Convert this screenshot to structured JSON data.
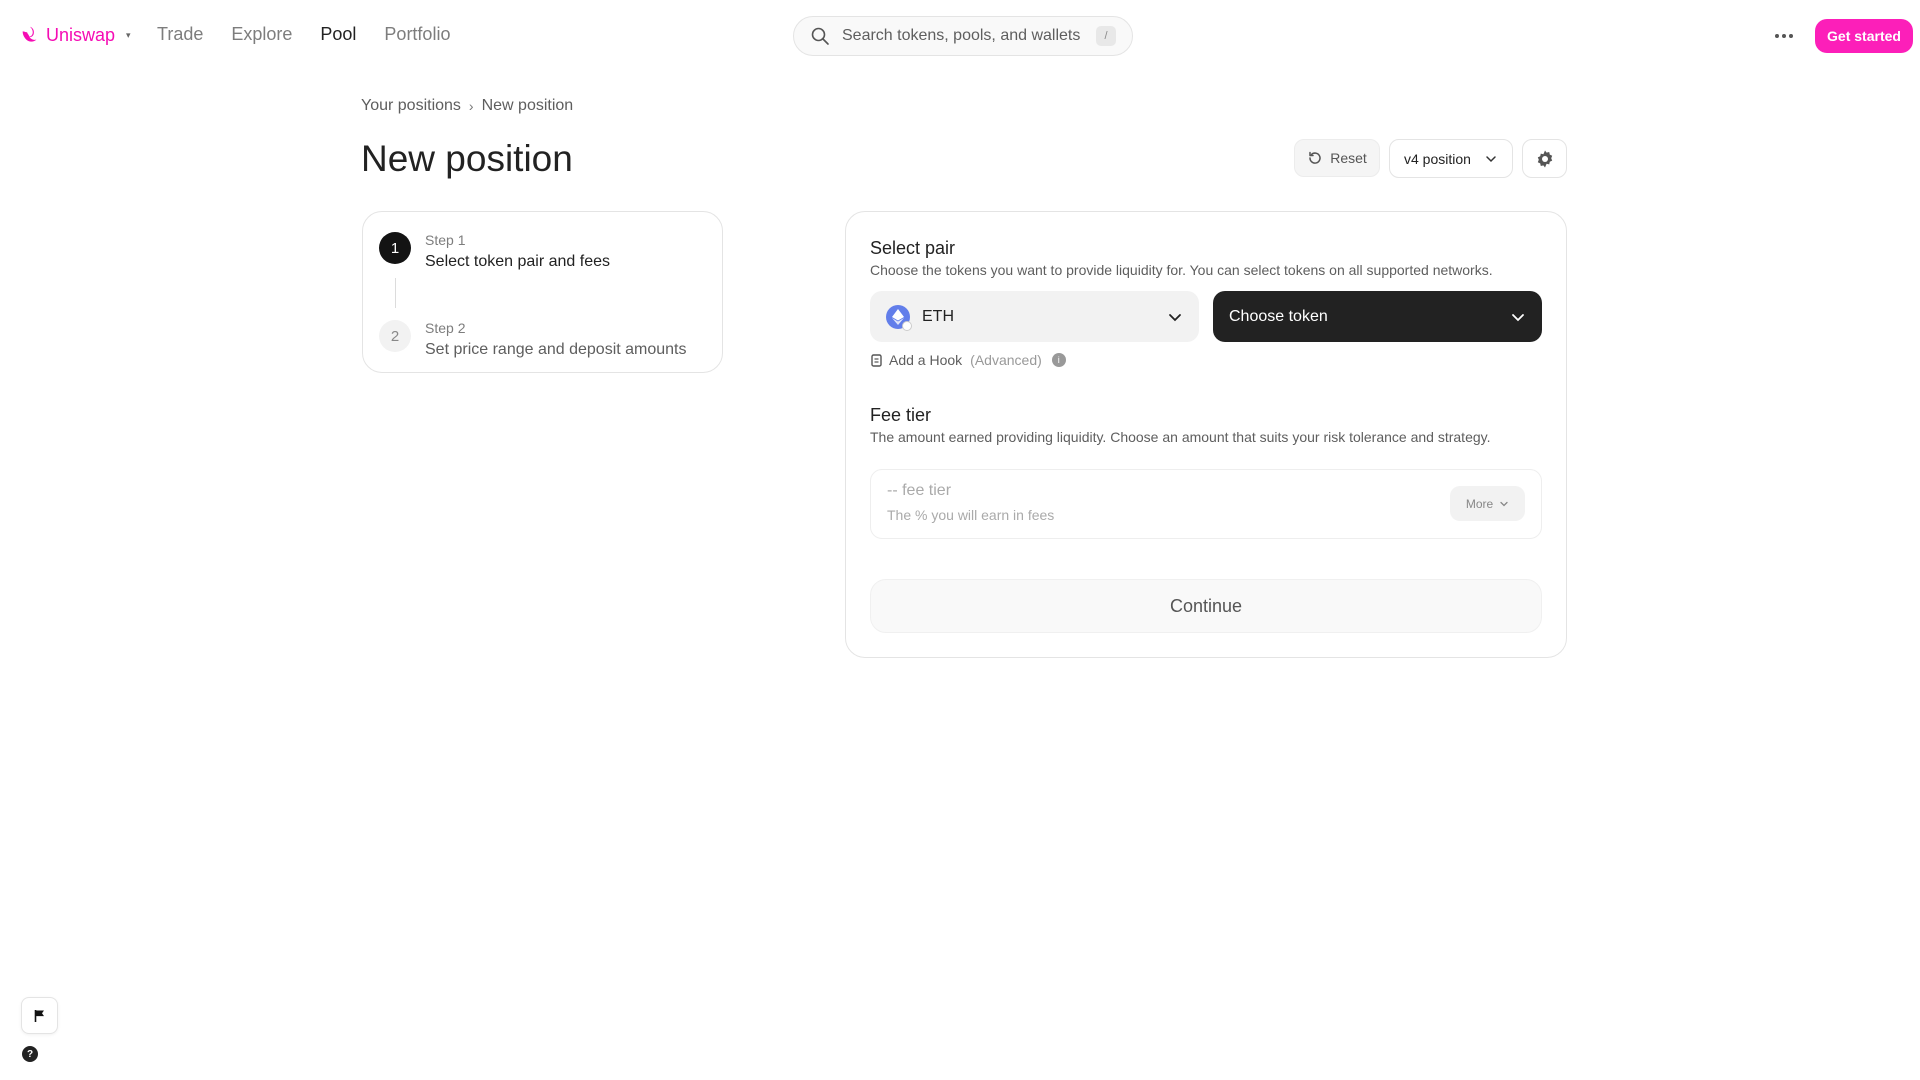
{
  "brand": {
    "name": "Uniswap",
    "caret": "▾",
    "color": "#f50db4"
  },
  "nav": {
    "items": [
      {
        "label": "Trade"
      },
      {
        "label": "Explore"
      },
      {
        "label": "Pool"
      },
      {
        "label": "Portfolio"
      }
    ],
    "active": "Pool"
  },
  "search": {
    "placeholder": "Search tokens, pools, and wallets",
    "shortcut": "/"
  },
  "header": {
    "get_started": "Get started"
  },
  "breadcrumb": {
    "parent": "Your positions",
    "current": "New position"
  },
  "page": {
    "title": "New position"
  },
  "toolbar": {
    "reset": "Reset",
    "version": "v4 position"
  },
  "steps": [
    {
      "number": "1",
      "sub": "Step 1",
      "title": "Select token pair and fees",
      "active": true
    },
    {
      "number": "2",
      "sub": "Step 2",
      "title": "Set price range and deposit amounts",
      "active": false
    }
  ],
  "pair": {
    "title": "Select pair",
    "desc": "Choose the tokens you want to provide liquidity for. You can select tokens on all supported networks.",
    "token_a": "ETH",
    "token_b": "Choose token",
    "hook_label": "Add a Hook",
    "hook_adv": "(Advanced)"
  },
  "fee": {
    "title": "Fee tier",
    "desc": "The amount earned providing liquidity. Choose an amount that suits your risk tolerance and strategy.",
    "tier": "-- fee tier",
    "tier_sub": "The % you will earn in fees",
    "more": "More"
  },
  "continue": "Continue",
  "colors": {
    "accent": "#fc1fb9",
    "dark": "#222222"
  }
}
